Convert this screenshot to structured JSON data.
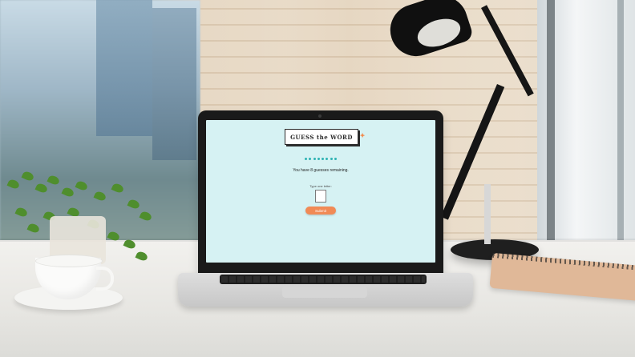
{
  "app": {
    "title": "GUESS the WORD",
    "remaining_text": "You have 8 guesses remaining.",
    "prompt": "Type one letter:",
    "submit_label": "Submit",
    "progress_dots": 8
  },
  "colors": {
    "screen_bg": "#d6f2f3",
    "accent": "#f18a55",
    "dot": "#2fb3b3"
  }
}
